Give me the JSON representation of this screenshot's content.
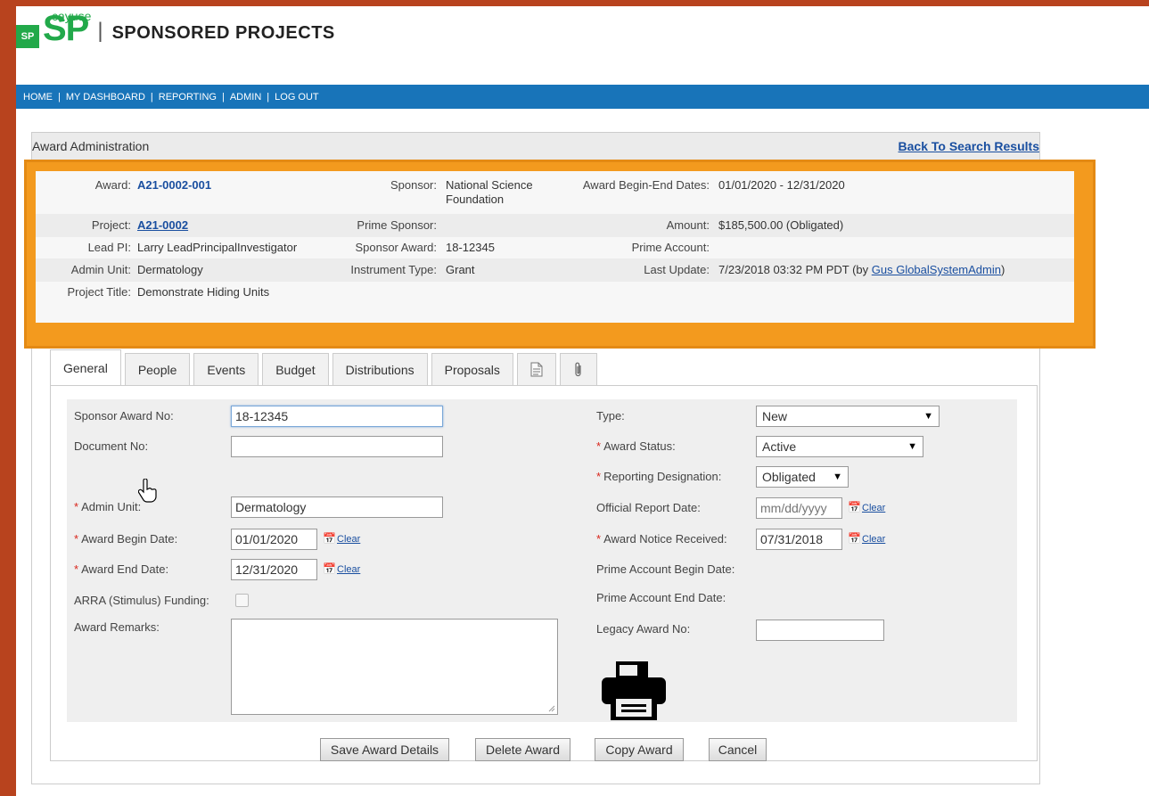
{
  "app": {
    "logo_box": "SP",
    "logo_main": "SP",
    "logo_small": "cayuse",
    "title": "SPONSORED PROJECTS"
  },
  "nav": {
    "items": [
      "HOME",
      "MY DASHBOARD",
      "REPORTING",
      "ADMIN",
      "LOG OUT"
    ],
    "separator": "|"
  },
  "header": {
    "title": "Award Administration",
    "back_link": "Back To Search Results"
  },
  "summary": {
    "award_label": "Award:",
    "award_value": "A21-0002-001",
    "sponsor_label": "Sponsor:",
    "sponsor_value": "National Science Foundation",
    "dates_label": "Award Begin-End Dates:",
    "dates_value": "01/01/2020 - 12/31/2020",
    "project_label": "Project:",
    "project_value": "A21-0002",
    "prime_sponsor_label": "Prime Sponsor:",
    "amount_label": "Amount:",
    "amount_value": "$185,500.00 (Obligated)",
    "lead_pi_label": "Lead PI:",
    "lead_pi_value": "Larry LeadPrincipalInvestigator",
    "sponsor_award_label": "Sponsor Award:",
    "sponsor_award_value": "18-12345",
    "prime_account_label": "Prime Account:",
    "admin_unit_label": "Admin Unit:",
    "admin_unit_value": "Dermatology",
    "instrument_label": "Instrument Type:",
    "instrument_value": "Grant",
    "last_update_label": "Last Update:",
    "last_update_value": "7/23/2018 03:32 PM PDT (by ",
    "last_update_user": "Gus GlobalSystemAdmin",
    "last_update_close": ")",
    "project_title_label": "Project Title:",
    "project_title_value": "Demonstrate Hiding Units"
  },
  "tabs": [
    "General",
    "People",
    "Events",
    "Budget",
    "Distributions",
    "Proposals"
  ],
  "form": {
    "sponsor_award_no_label": "Sponsor Award No:",
    "sponsor_award_no_value": "18-12345",
    "document_no_label": "Document No:",
    "document_no_value": "",
    "admin_unit_label": "Admin Unit:",
    "admin_unit_value": "Dermatology",
    "award_begin_label": "Award Begin Date:",
    "award_begin_value": "01/01/2020",
    "award_end_label": "Award End Date:",
    "award_end_value": "12/31/2020",
    "arra_label": "ARRA (Stimulus) Funding:",
    "remarks_label": "Award Remarks:",
    "type_label": "Type:",
    "type_value": "New",
    "status_label": "Award Status:",
    "status_value": "Active",
    "reporting_label": "Reporting Designation:",
    "reporting_value": "Obligated",
    "official_report_label": "Official Report Date:",
    "official_report_placeholder": "mm/dd/yyyy",
    "notice_received_label": "Award Notice Received:",
    "notice_received_value": "07/31/2018",
    "prime_begin_label": "Prime Account Begin Date:",
    "prime_end_label": "Prime Account End Date:",
    "legacy_label": "Legacy Award No:",
    "legacy_value": "",
    "clear_label": "Clear",
    "required_marker": "*"
  },
  "buttons": {
    "save": "Save Award Details",
    "delete": "Delete Award",
    "copy": "Copy Award",
    "cancel": "Cancel"
  },
  "colors": {
    "brand_green": "#22a94a",
    "nav_blue": "#1874b9",
    "highlight_orange": "#f39a1e",
    "background": "#b8431e"
  }
}
